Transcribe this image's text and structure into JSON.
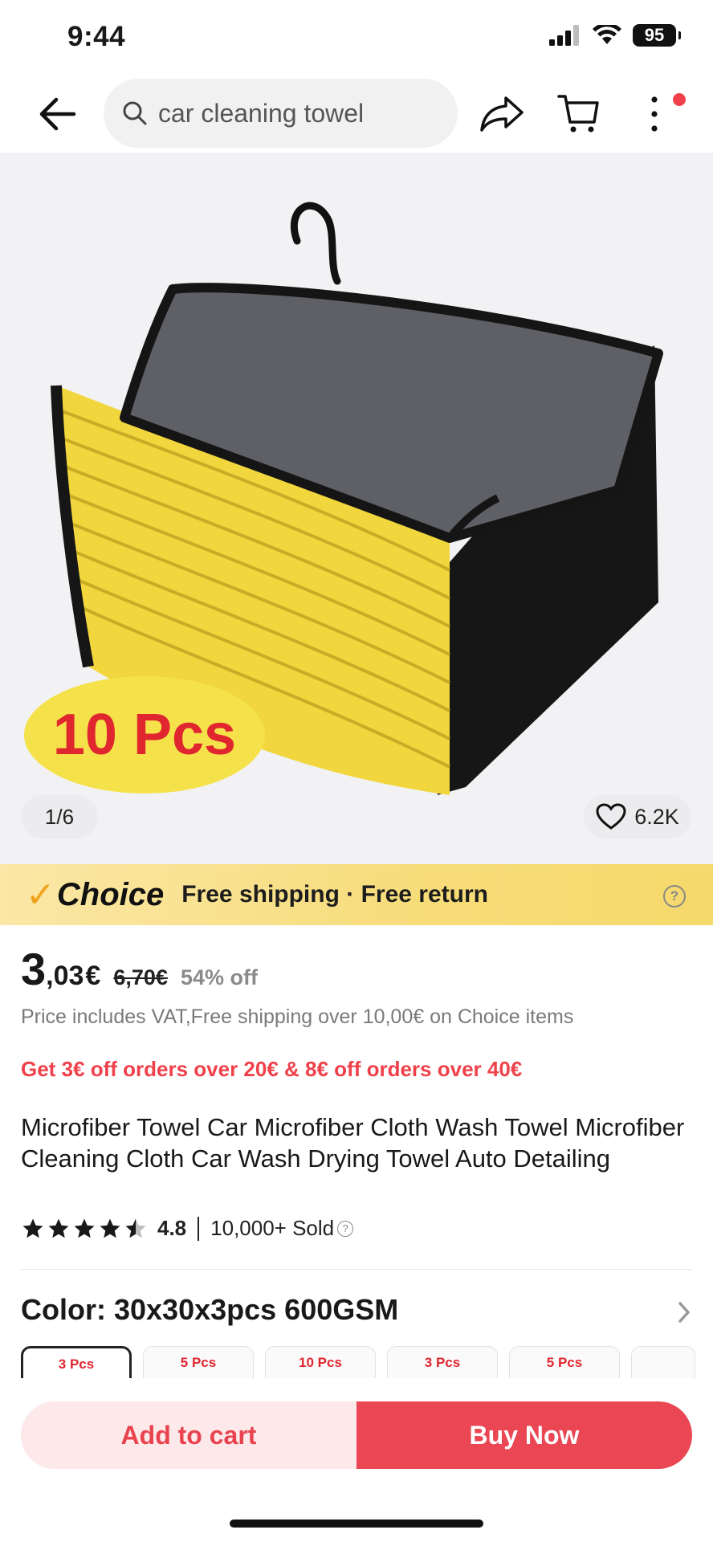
{
  "status_bar": {
    "time": "9:44",
    "battery": "95"
  },
  "header": {
    "search_value": "car cleaning towel"
  },
  "gallery": {
    "badge_text": "10 Pcs",
    "counter": "1/6",
    "favorites": "6.2K"
  },
  "choice_banner": {
    "logo_check": "✓",
    "logo_word": "Choice",
    "text": "Free shipping · Free return",
    "help": "?"
  },
  "price": {
    "integer": "3",
    "decimal": ",03",
    "currency": "€",
    "original": "6,70€",
    "discount": "54% off"
  },
  "vat_note": "Price includes VAT,Free shipping over 10,00€ on Choice items",
  "promo": "Get 3€ off orders over 20€ & 8€ off orders over 40€",
  "product_title": "Microfiber Towel Car Microfiber Cloth Wash Towel Microfiber Cleaning Cloth Car Wash Drying Towel Auto Detailing",
  "rating": {
    "value": "4.8",
    "stars": 4.5,
    "sold": "10,000+ Sold",
    "sold_help": "?"
  },
  "color_selector": {
    "label": "Color: 30x30x3pcs 600GSM",
    "variants": [
      {
        "label": "3 Pcs",
        "selected": true
      },
      {
        "label": "5 Pcs",
        "selected": false
      },
      {
        "label": "10 Pcs",
        "selected": false
      },
      {
        "label": "3 Pcs",
        "selected": false
      },
      {
        "label": "5 Pcs",
        "selected": false
      }
    ]
  },
  "actions": {
    "add_to_cart": "Add to cart",
    "buy_now": "Buy Now"
  },
  "colors": {
    "accent": "#ea4653",
    "accent_light": "#fde8ea",
    "choice_yellow": "#f7dc79",
    "badge_yellow": "#f5e24a",
    "badge_text": "#e0262f"
  },
  "icons": [
    "back-arrow-icon",
    "search-icon",
    "share-icon",
    "cart-icon",
    "more-icon",
    "heart-icon",
    "help-icon",
    "star-icon",
    "chevron-right-icon"
  ]
}
